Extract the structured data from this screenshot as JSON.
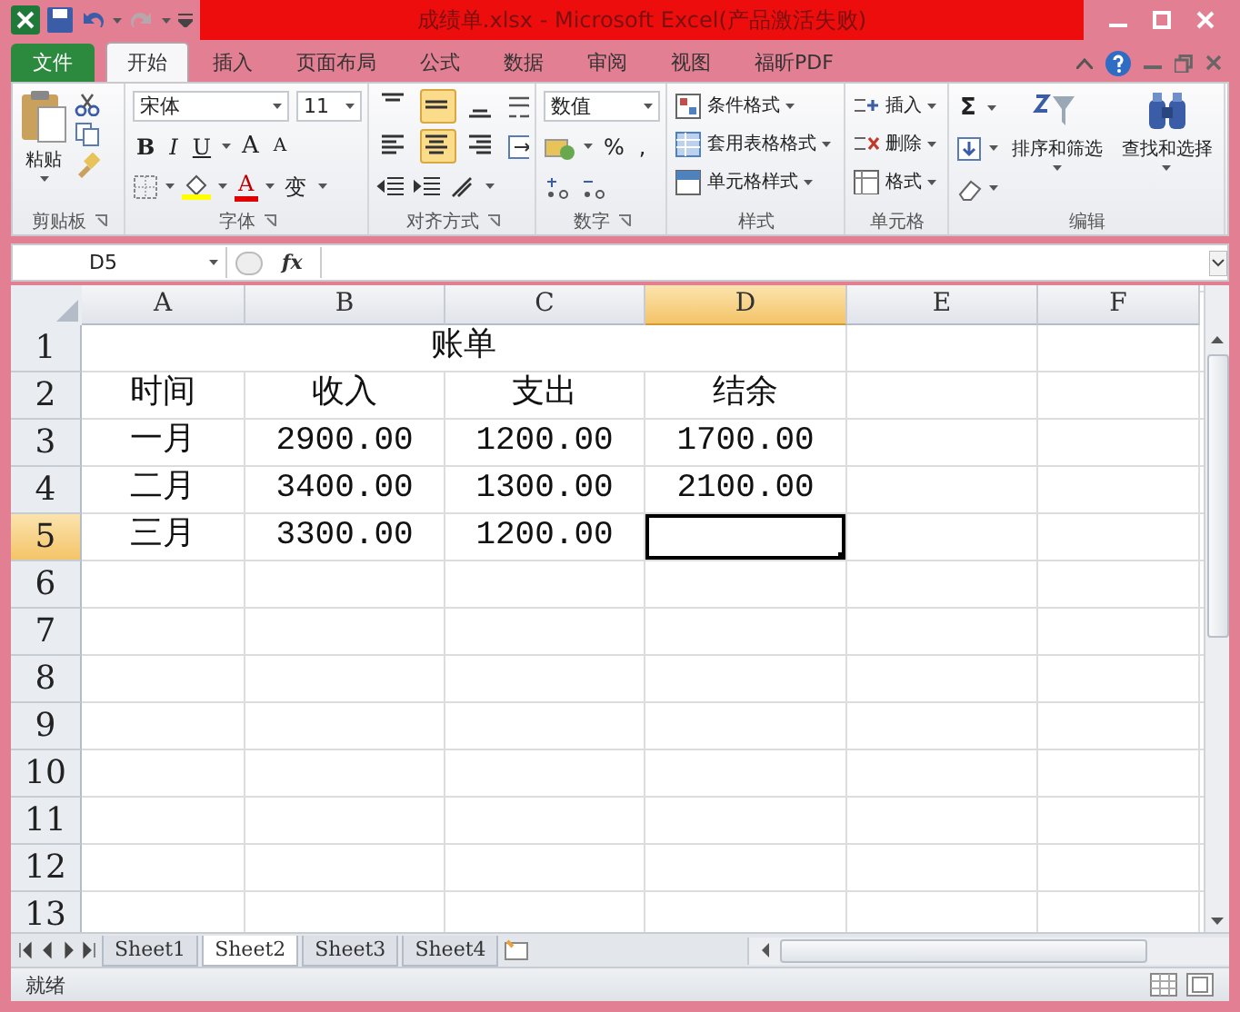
{
  "window": {
    "title": "成绩单.xlsx - Microsoft Excel(产品激活失败)"
  },
  "ribbon_tabs": [
    {
      "label": "文件",
      "kind": "file",
      "selected": false
    },
    {
      "label": "开始",
      "kind": "tab",
      "selected": true
    },
    {
      "label": "插入",
      "kind": "tab",
      "selected": false
    },
    {
      "label": "页面布局",
      "kind": "tab",
      "selected": false
    },
    {
      "label": "公式",
      "kind": "tab",
      "selected": false
    },
    {
      "label": "数据",
      "kind": "tab",
      "selected": false
    },
    {
      "label": "审阅",
      "kind": "tab",
      "selected": false
    },
    {
      "label": "视图",
      "kind": "tab",
      "selected": false
    },
    {
      "label": "福昕PDF",
      "kind": "tab",
      "selected": false
    }
  ],
  "ribbon": {
    "clipboard": {
      "label": "剪贴板",
      "paste": "粘贴"
    },
    "font": {
      "label": "字体",
      "font_name": "宋体",
      "font_size": "11",
      "bold": "B",
      "italic": "I",
      "underline": "U",
      "grow": "A",
      "shrink": "A",
      "font_color": "A",
      "phonetic": "变"
    },
    "alignment": {
      "label": "对齐方式",
      "vertical": [
        {
          "selected": false
        },
        {
          "selected": true
        },
        {
          "selected": false
        }
      ],
      "horizontal": [
        {
          "selected": false
        },
        {
          "selected": true
        },
        {
          "selected": false
        }
      ]
    },
    "number": {
      "label": "数字",
      "format": "数值",
      "percent": "%",
      "comma": ","
    },
    "styles": {
      "label": "样式",
      "buttons": [
        "条件格式",
        "套用表格格式",
        "单元格样式"
      ]
    },
    "cells": {
      "label": "单元格",
      "buttons": [
        "插入",
        "删除",
        "格式"
      ]
    },
    "editing": {
      "label": "编辑",
      "sum": "Σ",
      "buttons": [
        "排序和筛选",
        "查找和选择"
      ]
    }
  },
  "formula_bar": {
    "name_box": "D5",
    "function_label": "fx"
  },
  "sheet": {
    "columns": [
      {
        "label": "A",
        "selected": false
      },
      {
        "label": "B",
        "selected": false
      },
      {
        "label": "C",
        "selected": false
      },
      {
        "label": "D",
        "selected": true
      },
      {
        "label": "E",
        "selected": false
      },
      {
        "label": "F",
        "selected": false
      }
    ],
    "rows": [
      {
        "number": "1",
        "selected": false,
        "title": "账单"
      },
      {
        "number": "2",
        "selected": false,
        "cells": [
          {
            "text": "时间",
            "selected": false
          },
          {
            "text": "收入",
            "selected": false
          },
          {
            "text": "支出",
            "selected": false
          },
          {
            "text": "结余",
            "selected": false
          }
        ]
      },
      {
        "number": "3",
        "selected": false,
        "cells": [
          {
            "text": "一月",
            "selected": false
          },
          {
            "text": "2900.00",
            "selected": false
          },
          {
            "text": "1200.00",
            "selected": false
          },
          {
            "text": "1700.00",
            "selected": false
          }
        ]
      },
      {
        "number": "4",
        "selected": false,
        "cells": [
          {
            "text": "二月",
            "selected": false
          },
          {
            "text": "3400.00",
            "selected": false
          },
          {
            "text": "1300.00",
            "selected": false
          },
          {
            "text": "2100.00",
            "selected": false
          }
        ]
      },
      {
        "number": "5",
        "selected": true,
        "cells": [
          {
            "text": "三月",
            "selected": false
          },
          {
            "text": "3300.00",
            "selected": false
          },
          {
            "text": "1200.00",
            "selected": false
          },
          {
            "selected": true
          }
        ]
      },
      {
        "number": "6",
        "selected": false
      },
      {
        "number": "7",
        "selected": false
      },
      {
        "number": "8",
        "selected": false
      },
      {
        "number": "9",
        "selected": false
      },
      {
        "number": "10",
        "selected": false
      },
      {
        "number": "11",
        "selected": false
      },
      {
        "number": "12",
        "selected": false
      },
      {
        "number": "13",
        "selected": false
      }
    ]
  },
  "sheet_tabs": [
    {
      "label": "Sheet1",
      "selected": false
    },
    {
      "label": "Sheet2",
      "selected": true
    },
    {
      "label": "Sheet3",
      "selected": false
    },
    {
      "label": "Sheet4",
      "selected": false
    }
  ],
  "status_bar": {
    "text": "就绪"
  }
}
